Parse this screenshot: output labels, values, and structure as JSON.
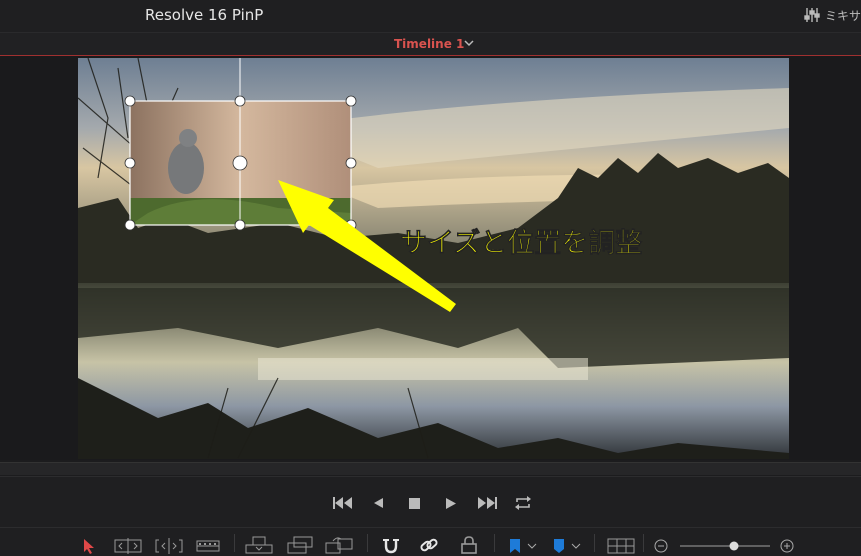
{
  "header": {
    "project_title": "Resolve 16 PinP",
    "mixer_label": "ミキサ"
  },
  "timeline": {
    "name": "Timeline 1"
  },
  "annotation": {
    "text": "サイズと位置を調整",
    "color": "#ffff00"
  },
  "colors": {
    "accent_red": "#d9534f",
    "flag_blue": "#1e7bd8",
    "annotation_yellow": "#ffff00"
  },
  "transport_icons": [
    "skip-to-start-icon",
    "step-back-icon",
    "stop-icon",
    "play-icon",
    "skip-to-end-icon",
    "loop-icon"
  ],
  "toolbar_icons": [
    "selection-tool-icon",
    "trim-edit-icon",
    "dynamic-trim-icon",
    "blade-icon",
    "insert-clip-icon",
    "overwrite-clip-icon",
    "replace-clip-icon",
    "snapping-icon",
    "linked-selection-icon",
    "position-lock-icon",
    "flag-icon",
    "marker-icon",
    "zoom-full-icon",
    "zoom-out-icon",
    "zoom-slider",
    "zoom-in-icon"
  ]
}
